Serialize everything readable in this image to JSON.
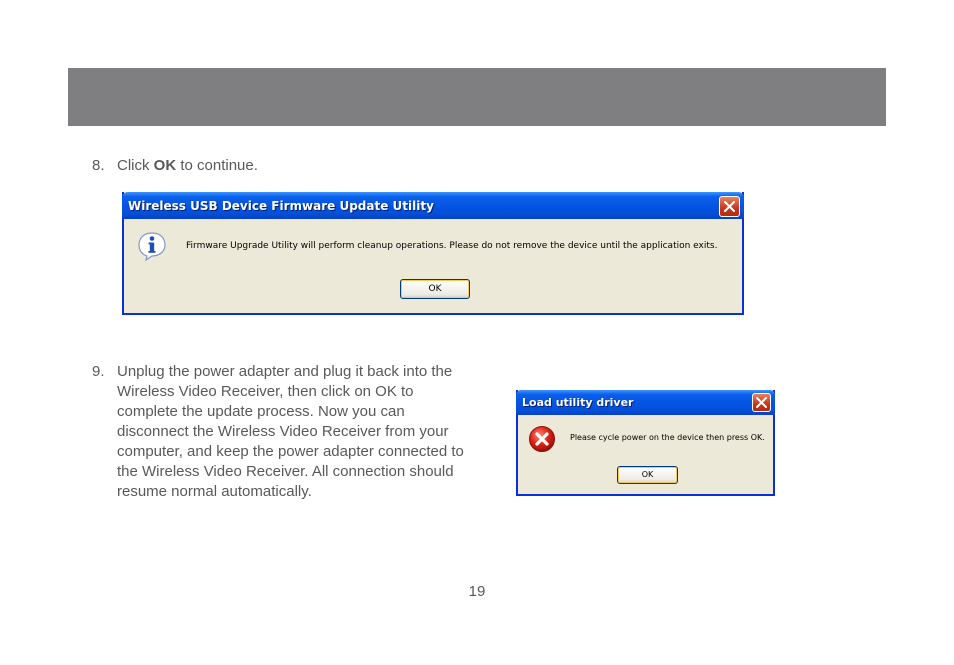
{
  "step8": {
    "number": "8.",
    "prefix": "Click ",
    "bold": "OK",
    "suffix": " to continue."
  },
  "dialog1": {
    "title": "Wireless USB Device Firmware Update Utility",
    "message": "Firmware Upgrade Utility will perform cleanup operations. Please do not remove the device until the application exits.",
    "ok_label": "OK",
    "icon": "info-icon"
  },
  "step9": {
    "number": "9.",
    "text": "Unplug the power adapter and plug it back into the Wireless Video Receiver, then click on OK to complete the update process.  Now you can disconnect the Wireless Video Receiver from your computer, and keep the power adapter connected to the Wireless Video Receiver.  All connection should resume normal automatically."
  },
  "dialog2": {
    "title": "Load utility driver",
    "message": "Please cycle power on the device then press OK.",
    "ok_label": "OK",
    "icon": "error-icon"
  },
  "page_number": "19",
  "colors": {
    "header_bar": "#7f7f82",
    "body_text": "#58595b",
    "xp_title_blue": "#0454e1",
    "xp_dialog_bg": "#ece9d8"
  }
}
